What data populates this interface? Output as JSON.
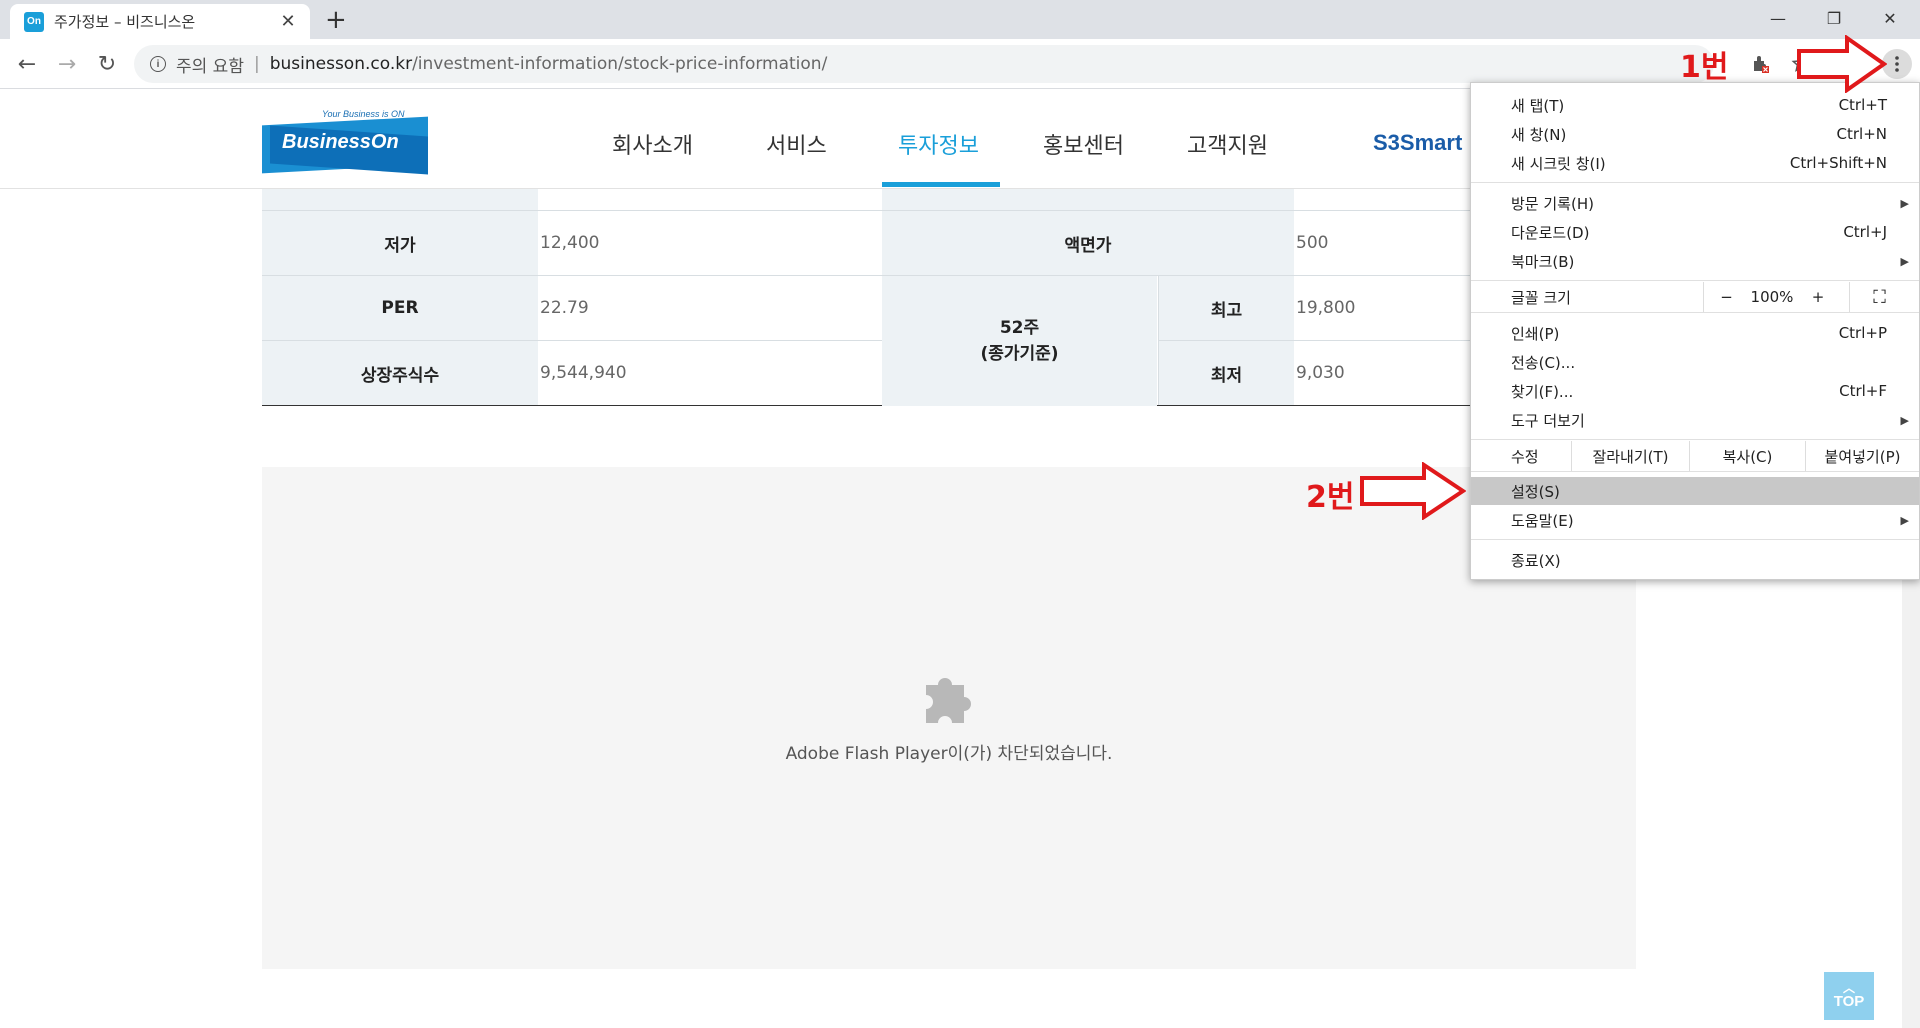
{
  "browser": {
    "tab_title": "주가정보 – 비즈니스온",
    "favicon_text": "On",
    "tab_close": "✕",
    "new_tab": "+",
    "window": {
      "minimize": "—",
      "restore": "❐",
      "close": "✕"
    },
    "nav": {
      "back": "←",
      "forward": "→",
      "reload": "↻"
    },
    "address": {
      "security_icon": "i",
      "security_label": "주의 요함",
      "separator": "|",
      "host": "businesson.co.kr",
      "path": "/investment-information/stock-price-information/"
    },
    "toolbar_icons": [
      "extension-blocked-icon",
      "star-icon",
      "profile-icon",
      "kebab-menu-icon"
    ]
  },
  "site": {
    "logo": {
      "tagline": "Your Business is ON",
      "name": "BusinessOn"
    },
    "gnb": [
      {
        "label": "회사소개"
      },
      {
        "label": "서비스"
      },
      {
        "label": "투자정보",
        "active": true
      },
      {
        "label": "홍보센터"
      },
      {
        "label": "고객지원"
      }
    ],
    "partner_logo": "S3Smart"
  },
  "stock_table": {
    "low_label": "저가",
    "low_value": "12,400",
    "face_label": "액면가",
    "face_value": "500",
    "per_label": "PER",
    "per_value": "22.79",
    "week52_label_line1": "52주",
    "week52_label_line2": "(종가기준)",
    "high_label": "최고",
    "high_value": "19,800",
    "listed_label": "상장주식수",
    "listed_value": "9,544,940",
    "min_label": "최저",
    "min_value": "9,030"
  },
  "flash": {
    "message": "Adobe Flash Player이(가) 차단되었습니다."
  },
  "top_button": {
    "label": "TOP",
    "chevron": "︿"
  },
  "chrome_menu": {
    "new_tab": {
      "label": "새 탭(T)",
      "shortcut": "Ctrl+T"
    },
    "new_window": {
      "label": "새 창(N)",
      "shortcut": "Ctrl+N"
    },
    "incognito": {
      "label": "새 시크릿 창(I)",
      "shortcut": "Ctrl+Shift+N"
    },
    "history": {
      "label": "방문 기록(H)"
    },
    "downloads": {
      "label": "다운로드(D)",
      "shortcut": "Ctrl+J"
    },
    "bookmarks": {
      "label": "북마크(B)"
    },
    "zoom": {
      "label": "글꼴 크기",
      "minus": "−",
      "value": "100%",
      "plus": "+",
      "fullscreen": "⛶"
    },
    "print": {
      "label": "인쇄(P)",
      "shortcut": "Ctrl+P"
    },
    "cast": {
      "label": "전송(C)..."
    },
    "find": {
      "label": "찾기(F)...",
      "shortcut": "Ctrl+F"
    },
    "more_tools": {
      "label": "도구 더보기"
    },
    "edit": {
      "label": "수정",
      "cut": "잘라내기(T)",
      "copy": "복사(C)",
      "paste": "붙여넣기(P)"
    },
    "settings": {
      "label": "설정(S)"
    },
    "help": {
      "label": "도움말(E)"
    },
    "exit": {
      "label": "종료(X)"
    },
    "submenu_arrow": "▶"
  },
  "annotations": {
    "step1": "1번",
    "step2": "2번",
    "color": "#e0191b"
  },
  "colors": {
    "accent": "#1a9fd9",
    "table_header_bg": "#edf2f5",
    "menu_highlight": "#c8c8c8"
  }
}
